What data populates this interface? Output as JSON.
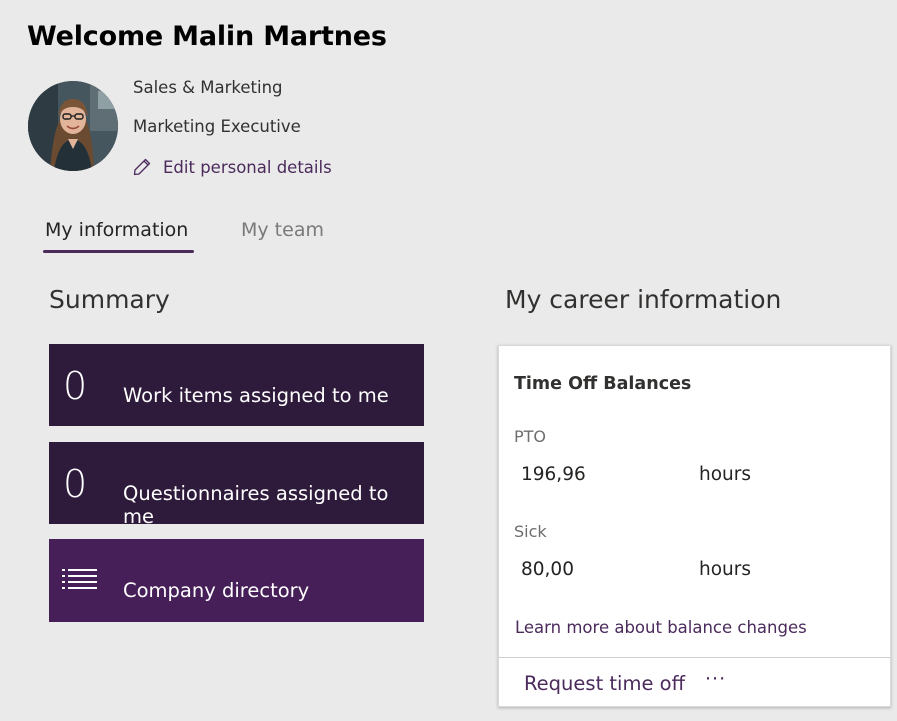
{
  "header": {
    "welcome": "Welcome Malin Martnes"
  },
  "profile": {
    "department": "Sales & Marketing",
    "job_title": "Marketing Executive",
    "edit_label": "Edit personal details",
    "edit_icon": "pencil-icon"
  },
  "tabs": [
    {
      "label": "My information",
      "active": true
    },
    {
      "label": "My team",
      "active": false
    }
  ],
  "summary": {
    "title": "Summary",
    "tiles": [
      {
        "count": "0",
        "label": "Work items assigned to me"
      },
      {
        "count": "0",
        "label": "Questionnaires assigned to me"
      },
      {
        "icon": "list-icon",
        "label": "Company directory"
      }
    ]
  },
  "career": {
    "title": "My career information",
    "card": {
      "title": "Time Off Balances",
      "balances": [
        {
          "label": "PTO",
          "value": "196,96",
          "unit": "hours"
        },
        {
          "label": "Sick",
          "value": "80,00",
          "unit": "hours"
        }
      ],
      "learn_more": "Learn more about balance changes",
      "request_label": "Request time off",
      "more_label": "···"
    }
  },
  "colors": {
    "accent": "#4b2a5c",
    "tile_dark": "#2e1a3b",
    "tile_light": "#461f58",
    "background": "#eaeaea"
  }
}
